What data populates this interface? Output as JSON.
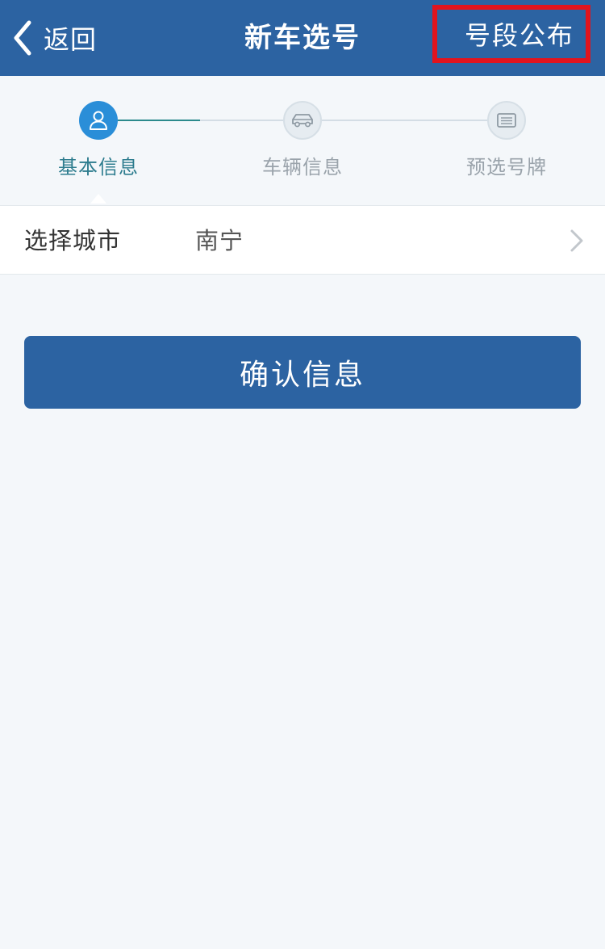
{
  "header": {
    "back_label": "返回",
    "title": "新车选号",
    "right_action_label": "号段公布"
  },
  "steps": [
    {
      "label": "基本信息",
      "state": "active",
      "icon": "person-icon"
    },
    {
      "label": "车辆信息",
      "state": "inactive",
      "icon": "car-icon"
    },
    {
      "label": "预选号牌",
      "state": "inactive",
      "icon": "license-plate-icon"
    }
  ],
  "form": {
    "city_label": "选择城市",
    "city_value": "南宁"
  },
  "confirm_button_label": "确认信息",
  "colors": {
    "primary": "#2c63a2",
    "active_step": "#2a8ed8",
    "highlight_border": "#e1141e",
    "background": "#f4f7fa"
  }
}
